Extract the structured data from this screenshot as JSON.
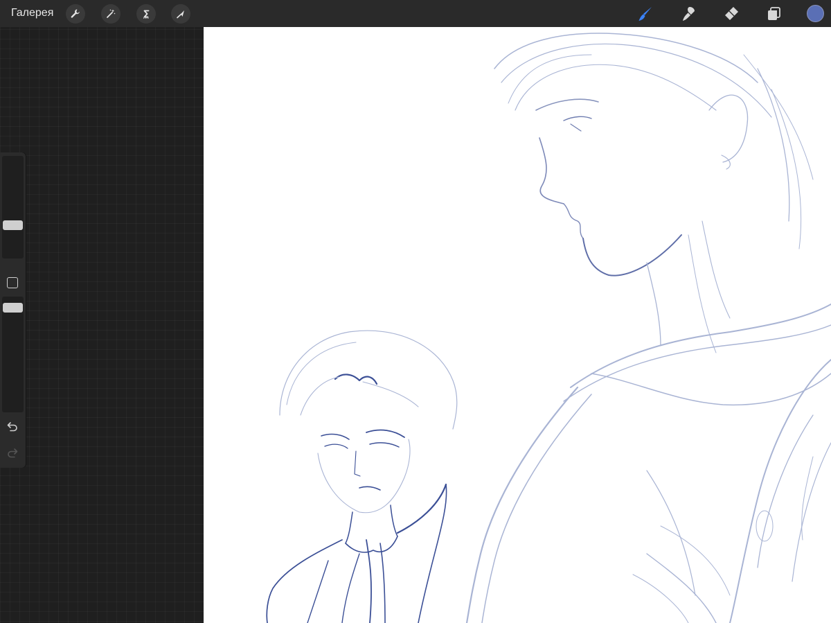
{
  "toolbar": {
    "gallery_label": "Галерея",
    "actions_icon": "wrench-icon",
    "adjustments_icon": "magic-wand-icon",
    "selection_icon": "selection-s-icon",
    "transform_icon": "arrow-cursor-icon",
    "brush_icon": "brush-icon",
    "smudge_icon": "smudge-icon",
    "eraser_icon": "eraser-icon",
    "layers_icon": "layers-icon",
    "current_color": "#5a6fb5"
  },
  "sidebar": {
    "brush_size_level": 0.3,
    "opacity_level": 0.95,
    "modify_icon": "square-icon",
    "undo_icon": "undo-icon",
    "redo_icon": "redo-icon"
  },
  "colors": {
    "accent": "#3b82f6",
    "sketch_dark": "#3b4f96",
    "sketch_light": "#a9b4d4",
    "canvas_bg": "#ffffff",
    "ui_bg": "#1f1f1f"
  }
}
